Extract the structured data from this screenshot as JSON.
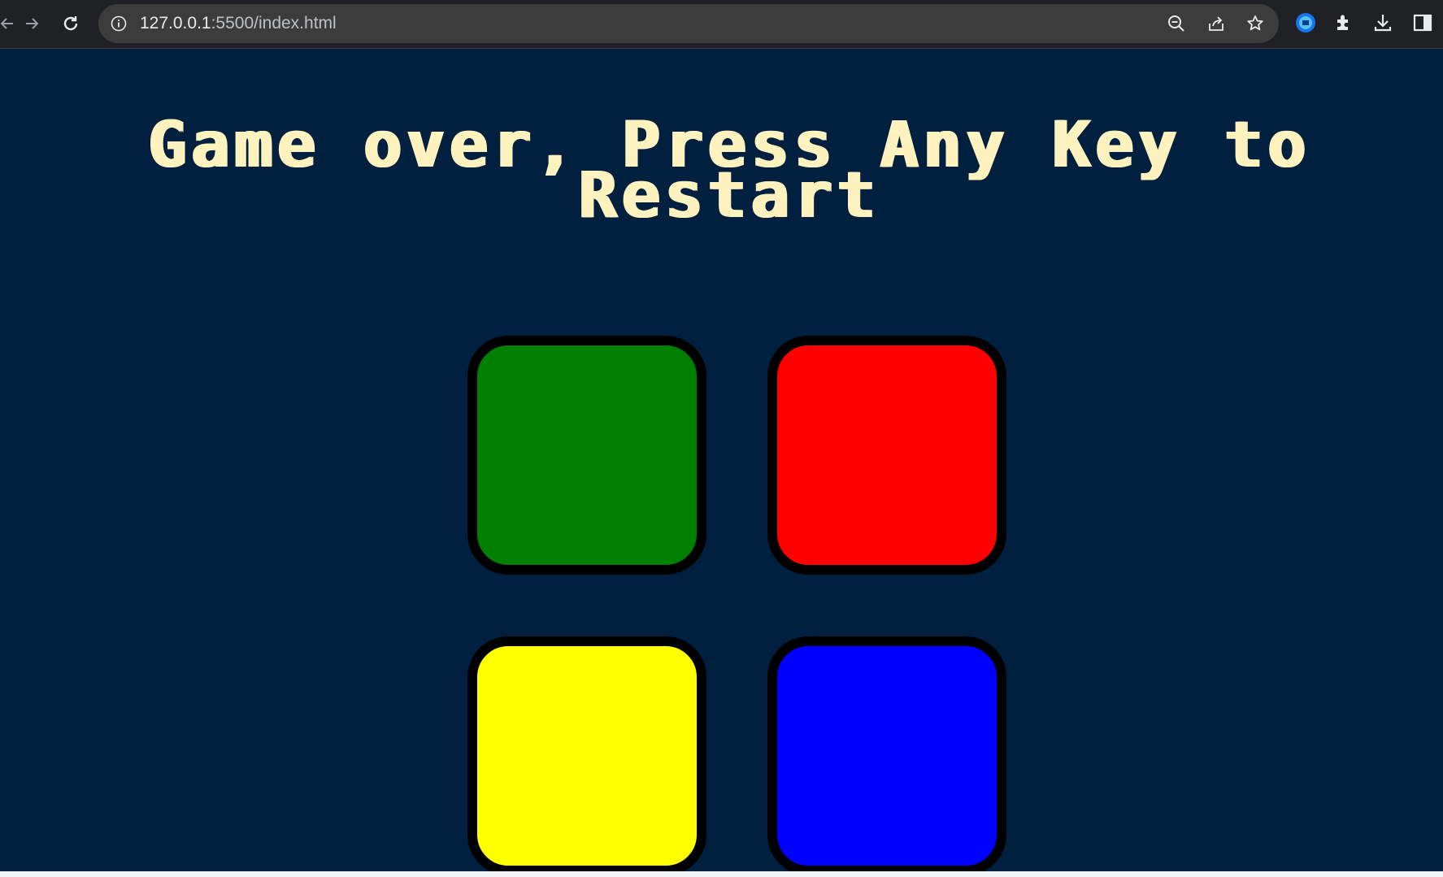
{
  "browser": {
    "url_host": "127.0.0.1",
    "url_rest": ":5500/index.html"
  },
  "game": {
    "title": "Game over, Press Any Key to Restart",
    "buttons": [
      {
        "id": "green",
        "color": "#008000"
      },
      {
        "id": "red",
        "color": "#FF0000"
      },
      {
        "id": "yellow",
        "color": "#FFFF00"
      },
      {
        "id": "blue",
        "color": "#0000FF"
      }
    ],
    "background": "#011F3F",
    "title_color": "#FEF2BF"
  },
  "icons": {
    "back": "back-arrow-icon",
    "forward": "forward-arrow-icon",
    "reload": "reload-icon",
    "site_info": "info-icon",
    "zoom": "zoom-out-icon",
    "share": "share-icon",
    "bookmark": "star-icon",
    "extension_badge": "extension-badge-icon",
    "extensions": "puzzle-icon",
    "download": "download-icon",
    "side_panel": "side-panel-icon"
  }
}
